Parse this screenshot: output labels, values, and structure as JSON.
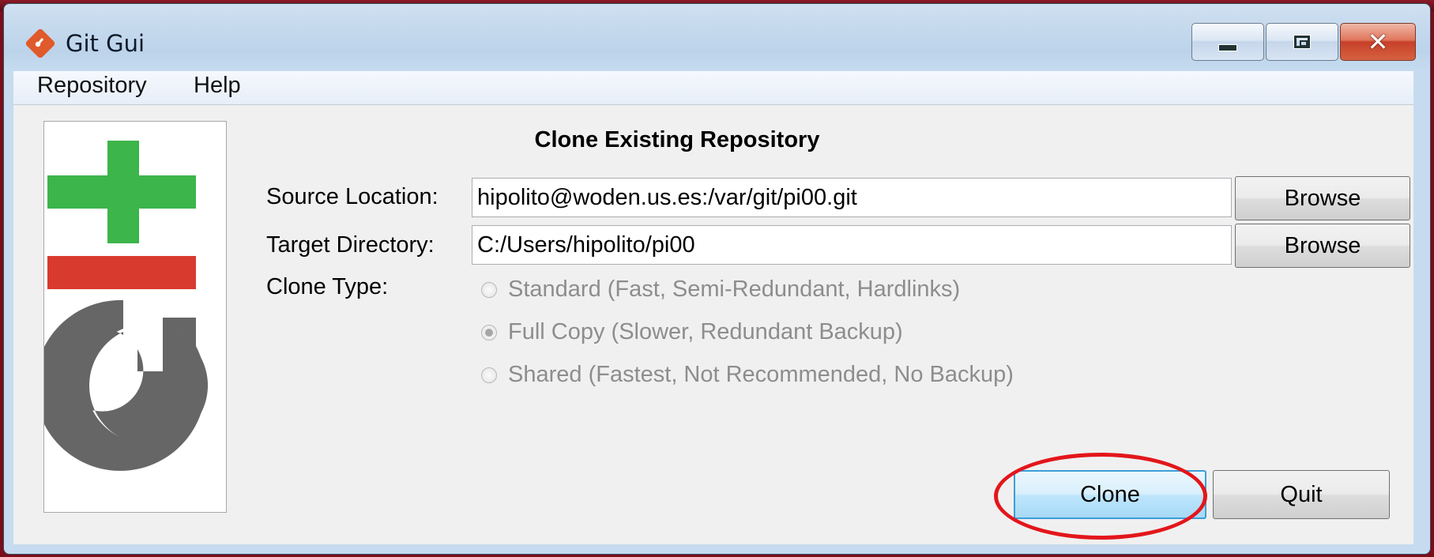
{
  "window": {
    "title": "Git Gui",
    "icon": "git-logo-icon",
    "controls": {
      "minimize": "minimize-icon",
      "maximize": "maximize-icon",
      "close": "close-icon",
      "close_glyph": "✕"
    }
  },
  "menu": {
    "items": [
      "Repository",
      "Help"
    ]
  },
  "dialog": {
    "heading": "Clone Existing Repository",
    "source_label": "Source Location:",
    "source_value": "hipolito@woden.us.es:/var/git/pi00.git",
    "target_label": "Target Directory:",
    "target_value": "C:/Users/hipolito/pi00",
    "browse_label": "Browse",
    "clone_type_label": "Clone Type:",
    "clone_types": [
      {
        "label": "Standard (Fast, Semi-Redundant, Hardlinks)",
        "selected": false
      },
      {
        "label": "Full Copy (Slower, Redundant Backup)",
        "selected": true
      },
      {
        "label": "Shared (Fastest, Not Recommended, No Backup)",
        "selected": false
      }
    ],
    "clone_label": "Clone",
    "quit_label": "Quit"
  },
  "colors": {
    "logo_plus": "#3cb54a",
    "logo_minus": "#d93a2e",
    "logo_g": "#666666",
    "annotation_ring": "#e3161b",
    "background": "#7a0d1a"
  }
}
